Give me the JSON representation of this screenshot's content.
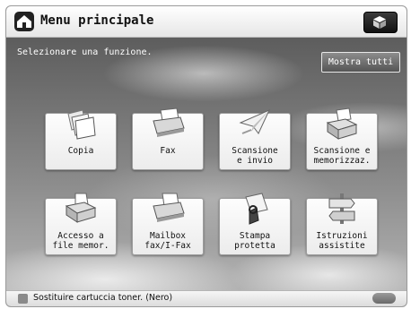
{
  "header": {
    "title": "Menu principale"
  },
  "main": {
    "instruction": "Selezionare una funzione.",
    "show_all_label": "Mostra tutti",
    "functions": [
      {
        "label": "Copia",
        "icon": "copy-icon"
      },
      {
        "label": "Fax",
        "icon": "fax-icon"
      },
      {
        "label": "Scansione\ne invio",
        "icon": "scan-send-icon"
      },
      {
        "label": "Scansione e\nmemorizzaz.",
        "icon": "scan-store-icon"
      },
      {
        "label": "Accesso a\nfile memor.",
        "icon": "stored-files-icon"
      },
      {
        "label": "Mailbox\nfax/I-Fax",
        "icon": "fax-mailbox-icon"
      },
      {
        "label": "Stampa\nprotetta",
        "icon": "secure-print-icon"
      },
      {
        "label": "Istruzioni\nassistite",
        "icon": "guide-signpost-icon"
      }
    ]
  },
  "status_bar": {
    "message": "Sostituire cartuccia toner. (Nero)"
  }
}
